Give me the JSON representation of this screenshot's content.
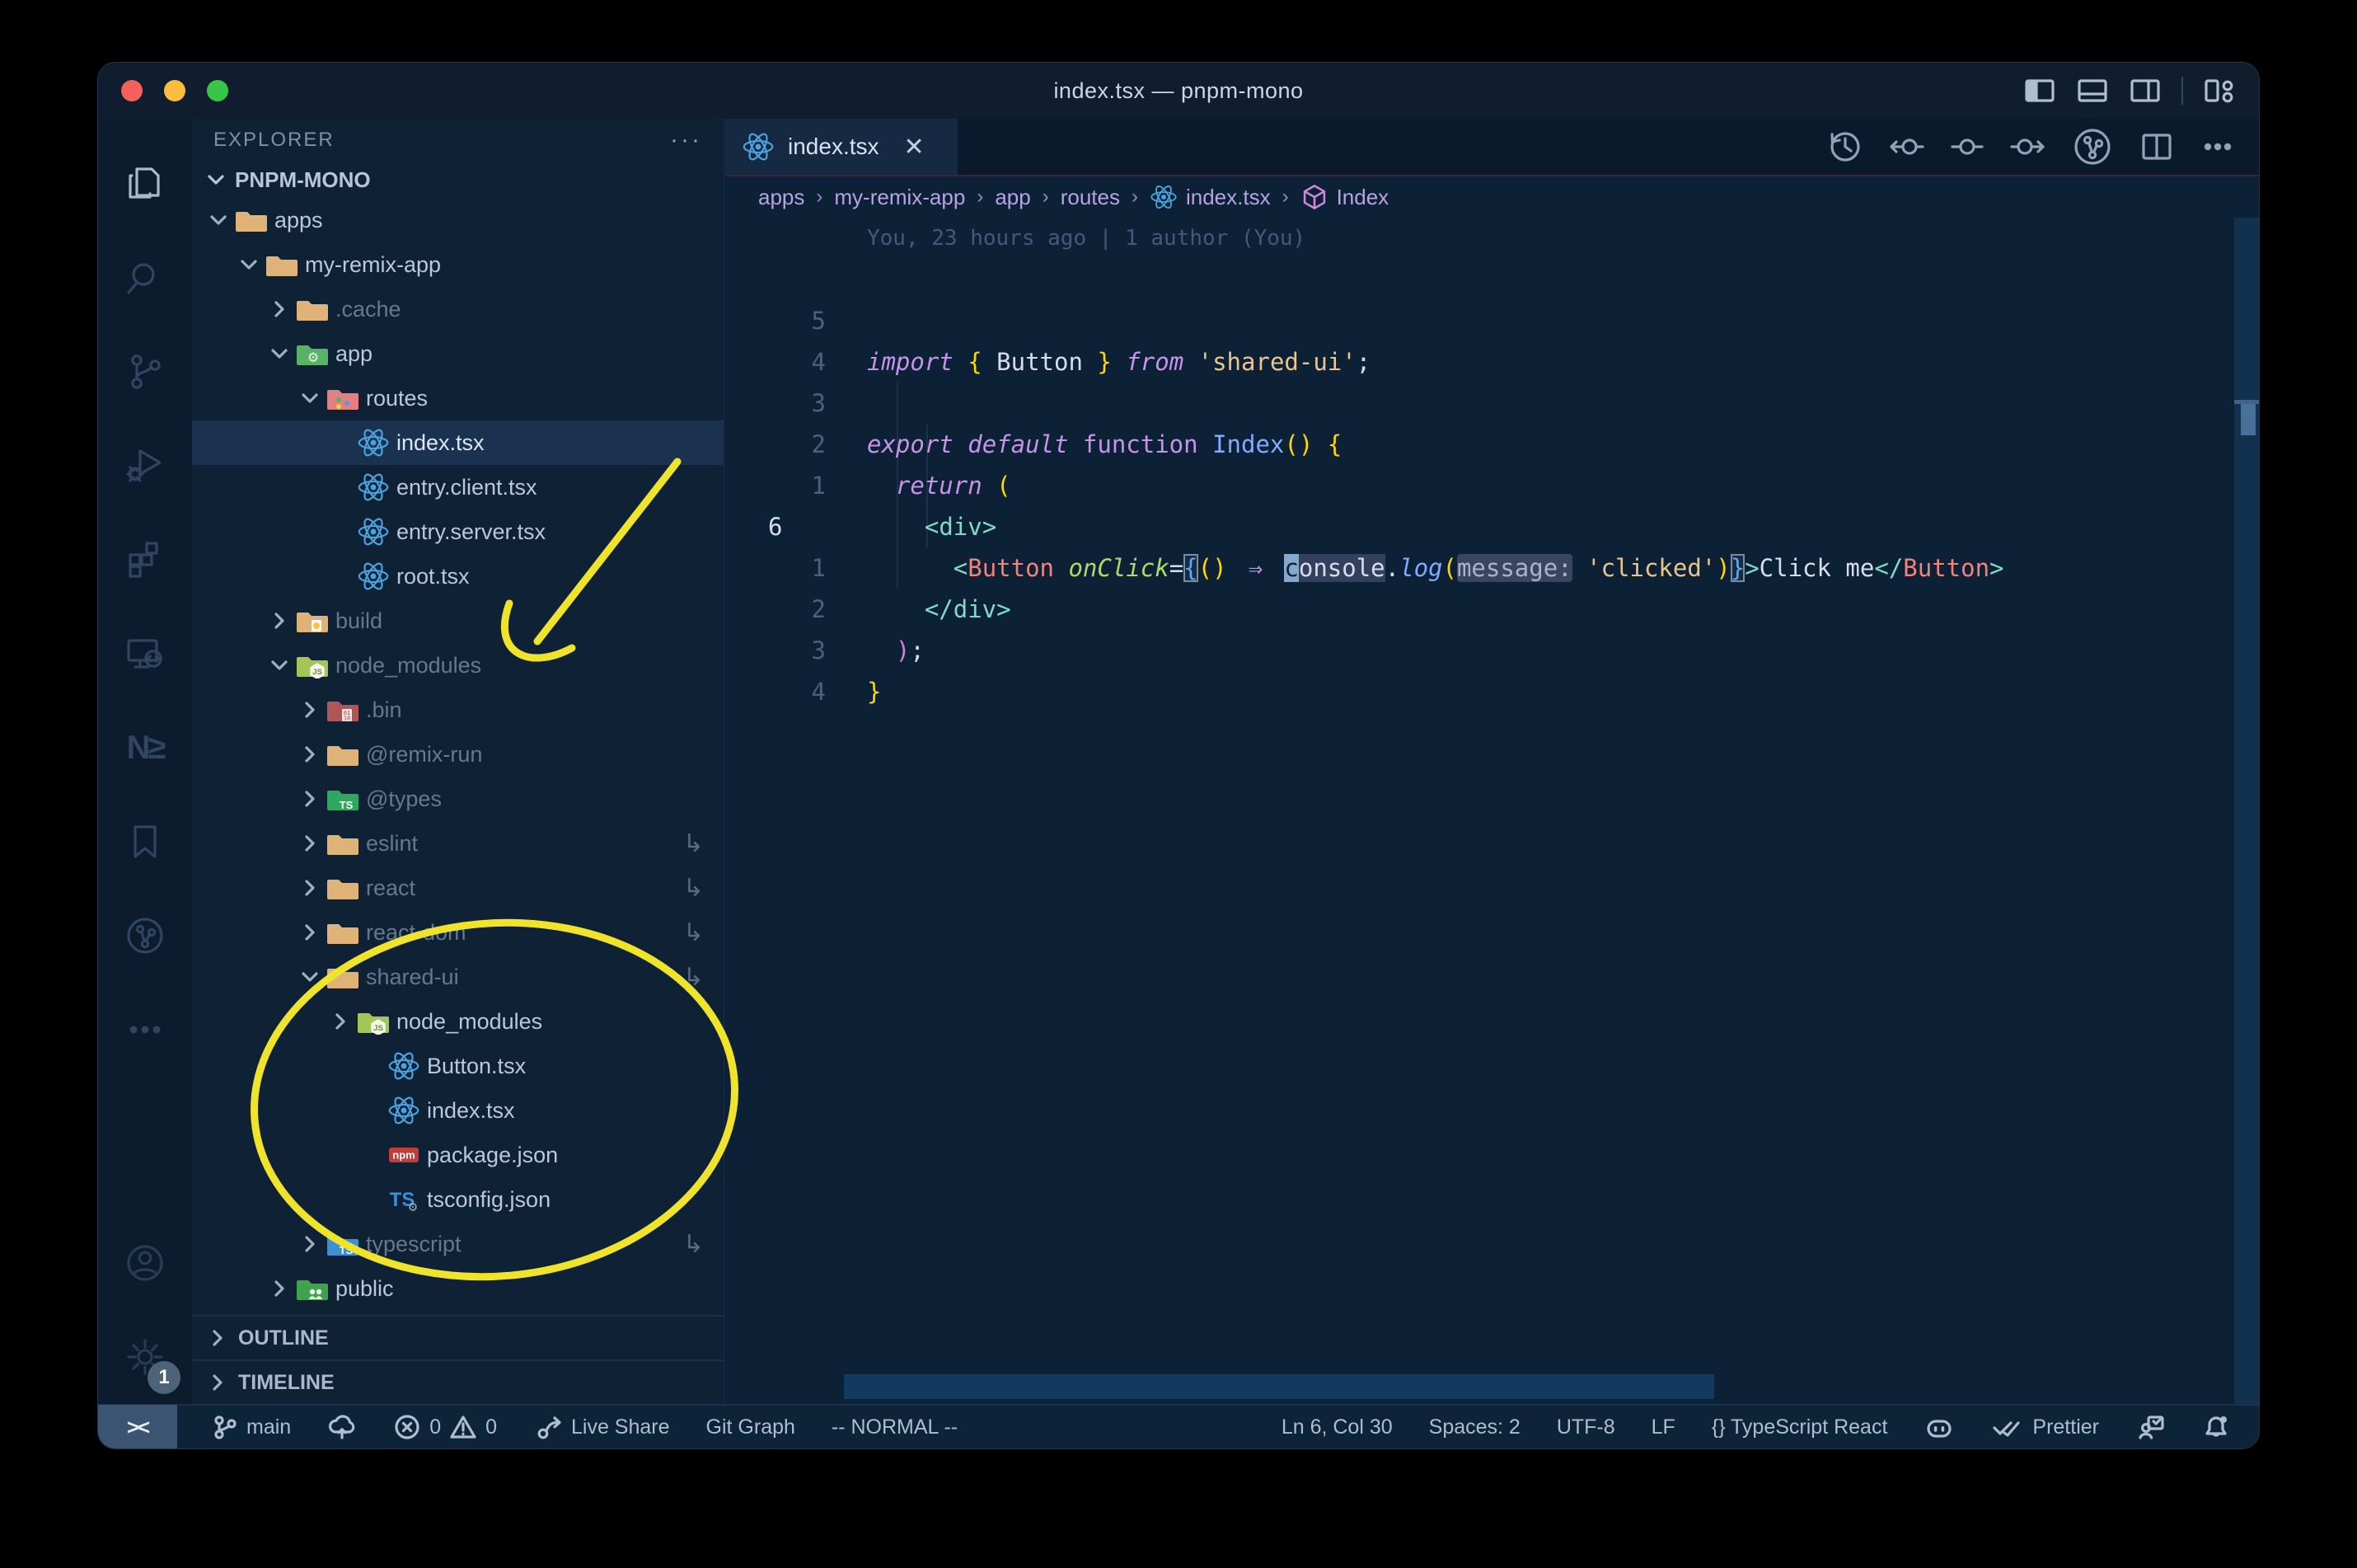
{
  "window": {
    "title": "index.tsx — pnpm-mono"
  },
  "titlebar": {
    "layout_icons": [
      "layout-sidebar-left-icon",
      "layout-panel-icon",
      "layout-sidebar-right-icon",
      "sep",
      "layout-customize-icon"
    ]
  },
  "activity_bar": {
    "top": [
      {
        "name": "explorer",
        "icon": "explorer",
        "active": true
      },
      {
        "name": "search",
        "icon": "search"
      },
      {
        "name": "source-control",
        "icon": "scm"
      },
      {
        "name": "run-debug",
        "icon": "debug"
      },
      {
        "name": "extensions",
        "icon": "extensions"
      },
      {
        "name": "remote-explorer",
        "icon": "remote"
      },
      {
        "name": "nx-console",
        "icon": "nx"
      },
      {
        "name": "bookmarks",
        "icon": "bookmark"
      },
      {
        "name": "git-graph",
        "icon": "gitgraph"
      },
      {
        "name": "more",
        "icon": "more"
      }
    ],
    "bottom": [
      {
        "name": "accounts",
        "icon": "account"
      },
      {
        "name": "settings",
        "icon": "gear",
        "badge": "1"
      }
    ]
  },
  "sidebar": {
    "header": "EXPLORER",
    "more": "···",
    "section": "PNPM-MONO",
    "tree": [
      {
        "label": "apps",
        "icon": "folder",
        "indent": 1,
        "chev": "open"
      },
      {
        "label": "my-remix-app",
        "icon": "folder",
        "indent": 2,
        "chev": "open"
      },
      {
        "label": ".cache",
        "icon": "folder",
        "indent": 3,
        "chev": "closed",
        "dim": true
      },
      {
        "label": "app",
        "icon": "folder-app",
        "indent": 3,
        "chev": "open"
      },
      {
        "label": "routes",
        "icon": "folder-routes",
        "indent": 4,
        "chev": "open"
      },
      {
        "label": "index.tsx",
        "icon": "react",
        "indent": 5,
        "selected": true
      },
      {
        "label": "entry.client.tsx",
        "icon": "react",
        "indent": 5
      },
      {
        "label": "entry.server.tsx",
        "icon": "react",
        "indent": 5
      },
      {
        "label": "root.tsx",
        "icon": "react",
        "indent": 5
      },
      {
        "label": "build",
        "icon": "folder-dist",
        "indent": 3,
        "chev": "closed",
        "dim": true
      },
      {
        "label": "node_modules",
        "icon": "folder-node",
        "indent": 3,
        "chev": "open",
        "dim": true
      },
      {
        "label": ".bin",
        "icon": "folder-bin",
        "indent": 4,
        "chev": "closed",
        "dim": true
      },
      {
        "label": "@remix-run",
        "icon": "folder",
        "indent": 4,
        "chev": "closed",
        "dim": true
      },
      {
        "label": "@types",
        "icon": "folder-types",
        "indent": 4,
        "chev": "closed",
        "dim": true
      },
      {
        "label": "eslint",
        "icon": "folder",
        "indent": 4,
        "chev": "closed",
        "dim": true,
        "symlink": true
      },
      {
        "label": "react",
        "icon": "folder",
        "indent": 4,
        "chev": "closed",
        "dim": true,
        "symlink": true
      },
      {
        "label": "react-dom",
        "icon": "folder",
        "indent": 4,
        "chev": "closed",
        "dim": true,
        "symlink": true
      },
      {
        "label": "shared-ui",
        "icon": "folder",
        "indent": 4,
        "chev": "open",
        "dim": true,
        "symlink": true
      },
      {
        "label": "node_modules",
        "icon": "folder-node",
        "indent": 5,
        "chev": "closed"
      },
      {
        "label": "Button.tsx",
        "icon": "react",
        "indent": 6
      },
      {
        "label": "index.tsx",
        "icon": "react",
        "indent": 6
      },
      {
        "label": "package.json",
        "icon": "npm",
        "indent": 6
      },
      {
        "label": "tsconfig.json",
        "icon": "tsconfig",
        "indent": 6
      },
      {
        "label": "typescript",
        "icon": "folder-ts",
        "indent": 4,
        "chev": "closed",
        "dim": true,
        "symlink": true
      },
      {
        "label": "public",
        "icon": "folder-public",
        "indent": 3,
        "chev": "closed"
      }
    ],
    "symlink_glyph": "↳",
    "sections": [
      "OUTLINE",
      "TIMELINE"
    ]
  },
  "editor": {
    "tab": {
      "label": "index.tsx",
      "icon": "react",
      "close": "✕"
    },
    "toolbar": [
      "history-icon",
      "prev-change-icon",
      "change-icon",
      "next-change-icon",
      "gitgraph-icon",
      "split-editor-icon",
      "more-actions-icon"
    ],
    "breadcrumbs": [
      {
        "label": "apps"
      },
      {
        "label": "my-remix-app"
      },
      {
        "label": "app"
      },
      {
        "label": "routes"
      },
      {
        "label": "index.tsx",
        "icon": "react"
      },
      {
        "label": "Index",
        "icon": "cube"
      }
    ],
    "breadcrumb_sep": "›",
    "blame": "You, 23 hours ago | 1 author (You)",
    "code_lines": [
      {
        "num": "5",
        "tokens": [
          [
            "import",
            "kw"
          ],
          [
            " ",
            "pl"
          ],
          [
            "{",
            "b1"
          ],
          [
            " Button ",
            "pl"
          ],
          [
            "}",
            "b1"
          ],
          [
            " ",
            "pl"
          ],
          [
            "from",
            "kw"
          ],
          [
            " ",
            "pl"
          ],
          [
            "'shared-ui'",
            "str"
          ],
          [
            ";",
            "pl"
          ]
        ]
      },
      {
        "num": "4",
        "tokens": []
      },
      {
        "num": "3",
        "tokens": [
          [
            "export",
            "kw"
          ],
          [
            " ",
            "pl"
          ],
          [
            "default",
            "kw"
          ],
          [
            " ",
            "pl"
          ],
          [
            "function",
            "kw2"
          ],
          [
            " ",
            "pl"
          ],
          [
            "Index",
            "fn"
          ],
          [
            "(",
            "b1"
          ],
          [
            ")",
            "b1"
          ],
          [
            " ",
            "pl"
          ],
          [
            "{",
            "b1"
          ]
        ]
      },
      {
        "num": "2",
        "tokens": [
          [
            "  ",
            "pl"
          ],
          [
            "return",
            "kw"
          ],
          [
            " ",
            "pl"
          ],
          [
            "(",
            "b1"
          ]
        ]
      },
      {
        "num": "1",
        "tokens": [
          [
            "    ",
            "pl"
          ],
          [
            "<",
            "tag"
          ],
          [
            "div",
            "tag"
          ],
          [
            ">",
            "tag"
          ]
        ]
      },
      {
        "num": "6",
        "current": true,
        "tokens": [
          [
            "      ",
            "pl"
          ],
          [
            "<",
            "tag"
          ],
          [
            "Button",
            "comp"
          ],
          [
            " ",
            "pl"
          ],
          [
            "onClick",
            "attr"
          ],
          [
            "=",
            "pl"
          ],
          [
            "{",
            "b3 mbox"
          ],
          [
            "(",
            "b1"
          ],
          [
            ")",
            "b1"
          ],
          [
            " ",
            "pl"
          ],
          [
            "⇒",
            "kw wide"
          ],
          [
            " ",
            "pl"
          ],
          [
            "c",
            "pl cur-block"
          ],
          [
            "onsole",
            "pl hl"
          ],
          [
            ".",
            "pl"
          ],
          [
            "log",
            "fni"
          ],
          [
            "(",
            "b1"
          ],
          [
            "message:",
            "inlay"
          ],
          [
            " ",
            "pl"
          ],
          [
            "'clicked'",
            "str"
          ],
          [
            ")",
            "b1"
          ],
          [
            "}",
            "b3 mbox"
          ],
          [
            ">",
            "tag"
          ],
          [
            "Click me",
            "pl"
          ],
          [
            "</",
            "tag"
          ],
          [
            "Button",
            "comp"
          ],
          [
            ">",
            "tag"
          ]
        ]
      },
      {
        "num": "1",
        "tokens": [
          [
            "    ",
            "pl"
          ],
          [
            "</",
            "tag"
          ],
          [
            "div",
            "tag"
          ],
          [
            ">",
            "tag"
          ]
        ]
      },
      {
        "num": "2",
        "tokens": [
          [
            "  ",
            "pl"
          ],
          [
            ")",
            "b2"
          ],
          [
            ";",
            "pl"
          ]
        ]
      },
      {
        "num": "3",
        "tokens": [
          [
            "}",
            "b1"
          ]
        ]
      },
      {
        "num": "4",
        "tokens": []
      }
    ]
  },
  "status_bar": {
    "remote": "><",
    "left": [
      {
        "icon": "branch",
        "label": "main",
        "name": "branch-indicator"
      },
      {
        "icon": "cloud",
        "label": "",
        "name": "sync-button"
      },
      {
        "icon": "error",
        "label": "0",
        "icon2": "warning",
        "label2": "0",
        "name": "problems-indicator"
      },
      {
        "icon": "share",
        "label": "Live Share",
        "name": "live-share-button"
      },
      {
        "label": "Git Graph",
        "name": "git-graph-button"
      },
      {
        "label": "-- NORMAL --",
        "name": "vim-mode-indicator"
      }
    ],
    "right": [
      {
        "label": "Ln 6, Col 30",
        "name": "cursor-position"
      },
      {
        "label": "Spaces: 2",
        "name": "indentation"
      },
      {
        "label": "UTF-8",
        "name": "encoding"
      },
      {
        "label": "LF",
        "name": "eol"
      },
      {
        "label": "{} TypeScript React",
        "name": "language-mode"
      },
      {
        "icon": "copilot",
        "label": "",
        "name": "copilot-status"
      },
      {
        "icon": "doublecheck",
        "label": "Prettier",
        "name": "formatter-status"
      },
      {
        "icon": "feedback",
        "label": "",
        "name": "feedback-button"
      },
      {
        "icon": "bell",
        "label": "",
        "name": "notifications-bell"
      }
    ]
  },
  "annotations": {
    "color": "#efe32b"
  },
  "colors": {
    "traffic_red": "#f4605a",
    "traffic_yellow": "#fbbd3f",
    "traffic_green": "#38c649",
    "selected_row": "#1b3150",
    "editor_bg": "#0c2136",
    "accent_string": "#ecc48d",
    "accent_keyword": "#c792ea",
    "accent_function": "#82aaff",
    "accent_tag": "#7fdbca"
  }
}
